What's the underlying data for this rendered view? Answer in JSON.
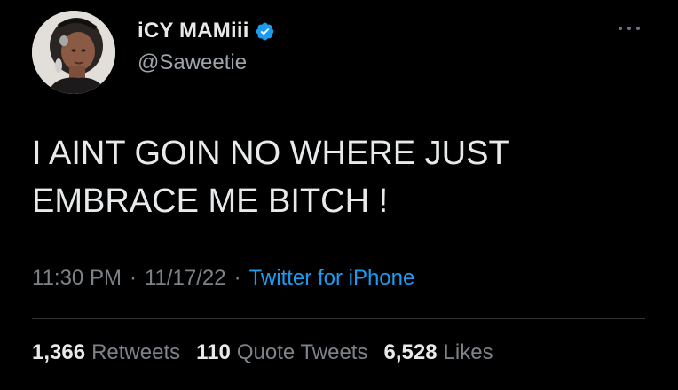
{
  "user": {
    "display_name": "iCY MAMiii",
    "handle": "@Saweetie",
    "verified_icon": "verified-badge-icon",
    "avatar": "profile-photo"
  },
  "tweet": {
    "text": "I AINT GOIN NO WHERE JUST\nEMBRACE ME BITCH !",
    "time": "11:30 PM",
    "separator": "·",
    "date": "11/17/22",
    "source": "Twitter for iPhone"
  },
  "stats": [
    {
      "value": "1,366",
      "label": "Retweets"
    },
    {
      "value": "110",
      "label": "Quote Tweets"
    },
    {
      "value": "6,528",
      "label": "Likes"
    }
  ],
  "icons": {
    "more": "more-options-icon"
  },
  "colors": {
    "background": "#000000",
    "text": "#e7e9ea",
    "secondary": "#7d8287",
    "accent": "#1d9bf0",
    "divider": "#2f3336"
  }
}
